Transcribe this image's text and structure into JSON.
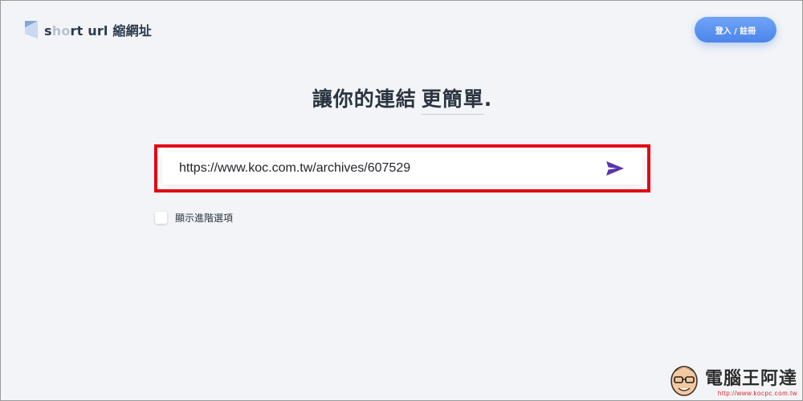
{
  "header": {
    "logo_text_dark_1": "s",
    "logo_text_fade": "ho",
    "logo_text_dark_2": "rt url 縮網址",
    "login_label": "登入 / 註冊"
  },
  "hero": {
    "headline_main": "讓你的連結",
    "headline_emph": "更簡單",
    "headline_end": "."
  },
  "shortener": {
    "url_value": "https://www.koc.com.tw/archives/607529",
    "options_label": "顯示進階選項",
    "options_checked": false
  },
  "watermark": {
    "title": "電腦王阿達",
    "url": "http://www.kocpc.com.tw"
  },
  "colors": {
    "accent": "#4c84ea",
    "send_icon": "#5b35a8",
    "highlight_border": "#e30613",
    "background": "#f2f4f7"
  },
  "icons": {
    "logo": "logo-mark-icon",
    "send": "send-arrow-icon",
    "watermark_face": "mascot-face-icon"
  }
}
